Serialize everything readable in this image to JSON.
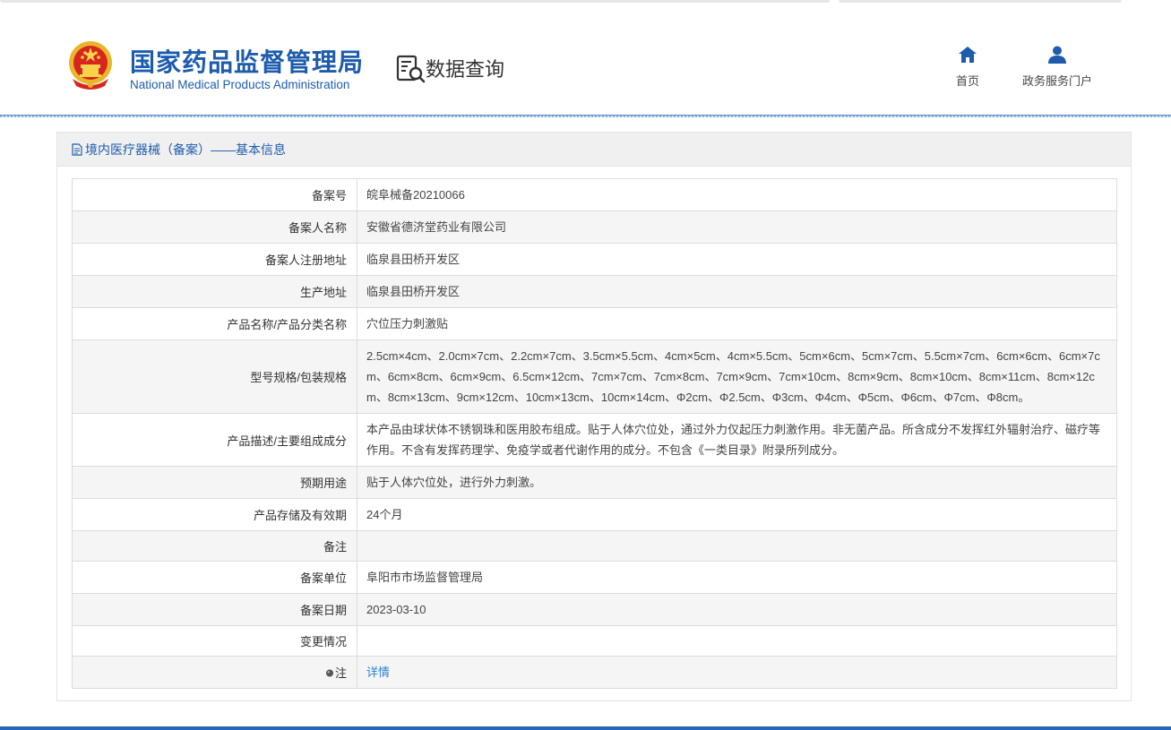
{
  "header": {
    "org_name_cn": "国家药品监督管理局",
    "org_name_en": "National Medical Products Administration",
    "section_title": "数据查询",
    "nav": [
      {
        "label": "首页",
        "icon": "home-icon"
      },
      {
        "label": "政务服务门户",
        "icon": "user-icon"
      }
    ]
  },
  "colors": {
    "brand": "#1d5cad",
    "link": "#2a7fd4",
    "stripe": "#f5f5f5"
  },
  "panel": {
    "title": "境内医疗器械（备案）——基本信息",
    "rows": [
      {
        "label": "备案号",
        "value": "皖阜械备20210066"
      },
      {
        "label": "备案人名称",
        "value": "安徽省德济堂药业有限公司"
      },
      {
        "label": "备案人注册地址",
        "value": "临泉县田桥开发区"
      },
      {
        "label": "生产地址",
        "value": "临泉县田桥开发区"
      },
      {
        "label": "产品名称/产品分类名称",
        "value": "穴位压力刺激贴"
      },
      {
        "label": "型号规格/包装规格",
        "value": "2.5cm×4cm、2.0cm×7cm、2.2cm×7cm、3.5cm×5.5cm、4cm×5cm、4cm×5.5cm、5cm×6cm、5cm×7cm、5.5cm×7cm、6cm×6cm、6cm×7cm、6cm×8cm、6cm×9cm、6.5cm×12cm、7cm×7cm、7cm×8cm、7cm×9cm、7cm×10cm、8cm×9cm、8cm×10cm、8cm×11cm、8cm×12cm、8cm×13cm、9cm×12cm、10cm×13cm、10cm×14cm、Φ2cm、Φ2.5cm、Φ3cm、Φ4cm、Φ5cm、Φ6cm、Φ7cm、Φ8cm。"
      },
      {
        "label": "产品描述/主要组成成分",
        "value": "本产品由球状体不锈钢珠和医用胶布组成。贴于人体穴位处，通过外力仅起压力刺激作用。非无菌产品。所含成分不发挥红外辐射治疗、磁疗等作用。不含有发挥药理学、免疫学或者代谢作用的成分。不包含《一类目录》附录所列成分。"
      },
      {
        "label": "预期用途",
        "value": "贴于人体穴位处，进行外力刺激。"
      },
      {
        "label": "产品存储及有效期",
        "value": "24个月"
      },
      {
        "label": "备注",
        "value": ""
      },
      {
        "label": "备案单位",
        "value": "阜阳市市场监督管理局"
      },
      {
        "label": "备案日期",
        "value": "2023-03-10"
      },
      {
        "label": "变更情况",
        "value": ""
      }
    ],
    "note": {
      "label": "注",
      "link_text": "详情"
    }
  }
}
